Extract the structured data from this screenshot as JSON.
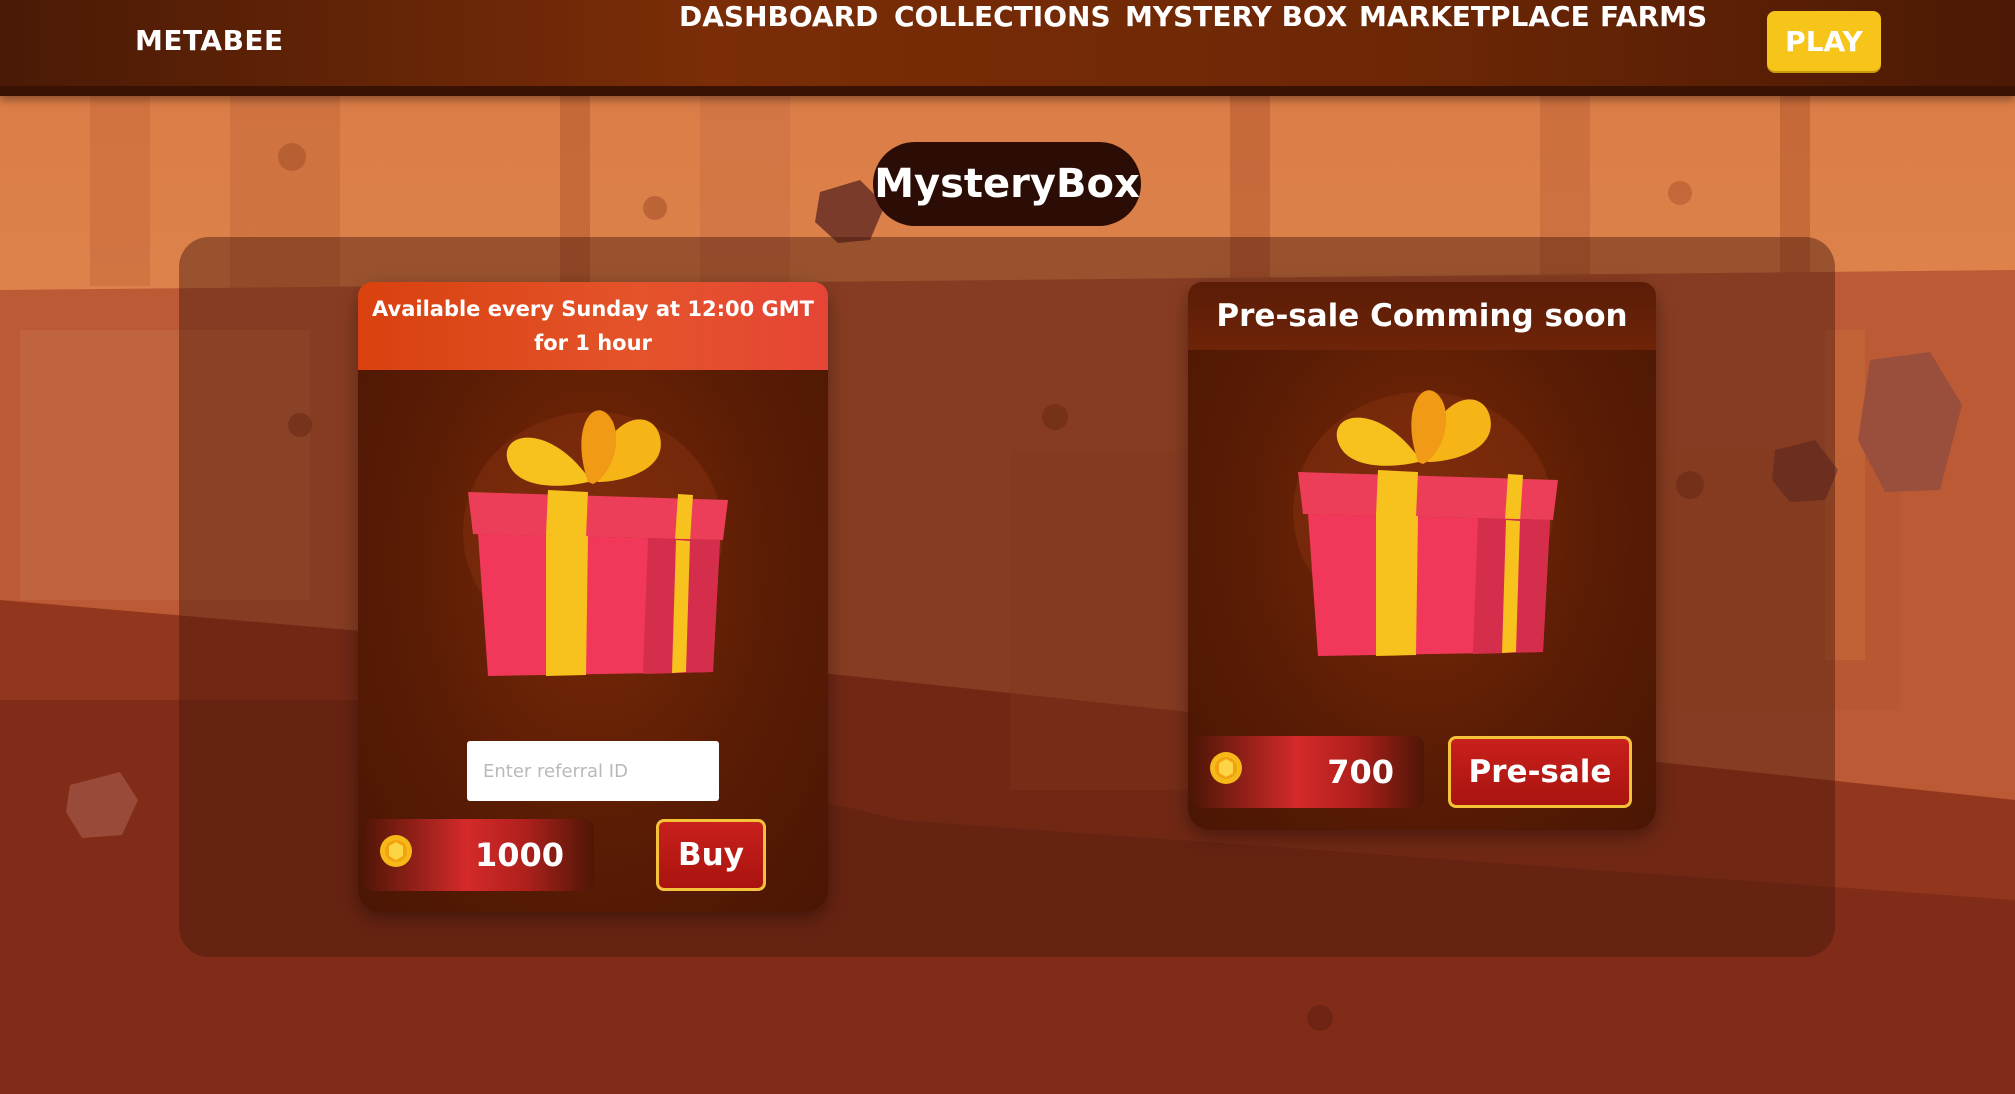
{
  "app": {
    "logo": "METABEE"
  },
  "nav": {
    "items": [
      {
        "label": "DASHBOARD"
      },
      {
        "label": "COLLECTIONS"
      },
      {
        "label": "MYSTERY BOX"
      },
      {
        "label": "MARKETPLACE"
      },
      {
        "label": "FARMS"
      }
    ],
    "play_label": "PLAY"
  },
  "page": {
    "title": "MysteryBox"
  },
  "cards": [
    {
      "header_line1": "Available every Sunday at 12:00 GMT",
      "header_line2": "for 1 hour",
      "referral_placeholder": "Enter referral ID",
      "price": "1000",
      "action_label": "Buy"
    },
    {
      "header": "Pre-sale Comming soon",
      "price": "700",
      "action_label": "Pre-sale"
    }
  ],
  "colors": {
    "accent_yellow": "#f7c51a",
    "nav_bg": "#6d2705",
    "button_red": "#c9201c",
    "button_border": "#f4c33a"
  },
  "icons": {
    "coin": "honeycomb-coin-icon",
    "gift": "gift-box-icon"
  }
}
